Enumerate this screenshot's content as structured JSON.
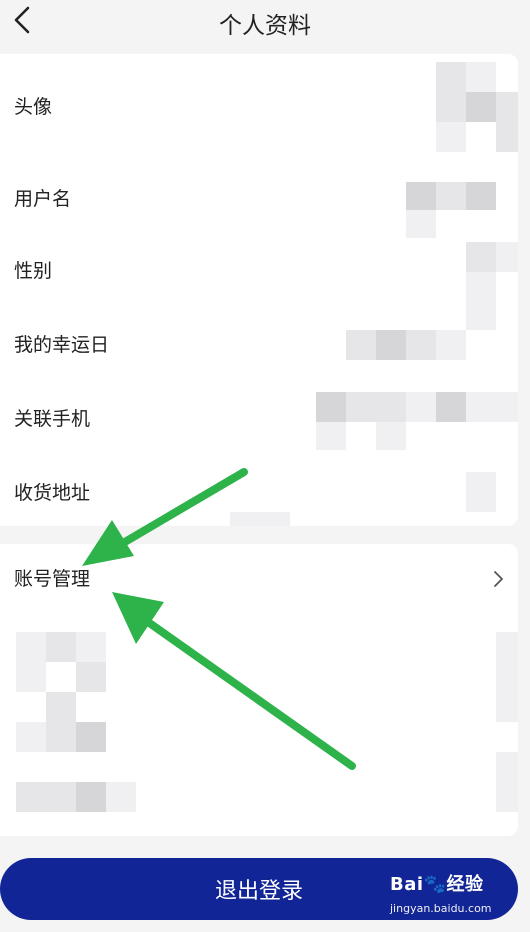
{
  "header": {
    "title": "个人资料",
    "back_icon": "chevron-left-icon"
  },
  "profile": {
    "rows": [
      {
        "label": "头像"
      },
      {
        "label": "用户名"
      },
      {
        "label": "性别"
      },
      {
        "label": "我的幸运日"
      },
      {
        "label": "关联手机"
      },
      {
        "label": "收货地址"
      }
    ]
  },
  "account": {
    "label": "账号管理",
    "chevron_icon": "chevron-right-icon"
  },
  "logout": {
    "label": "退出登录"
  },
  "colors": {
    "logout_button": "#122596",
    "annotation_arrow": "#2db34a",
    "background": "#f4f4f5"
  },
  "watermark": {
    "logo": "Bai🐾经验",
    "url": "jingyan.baidu.com"
  }
}
